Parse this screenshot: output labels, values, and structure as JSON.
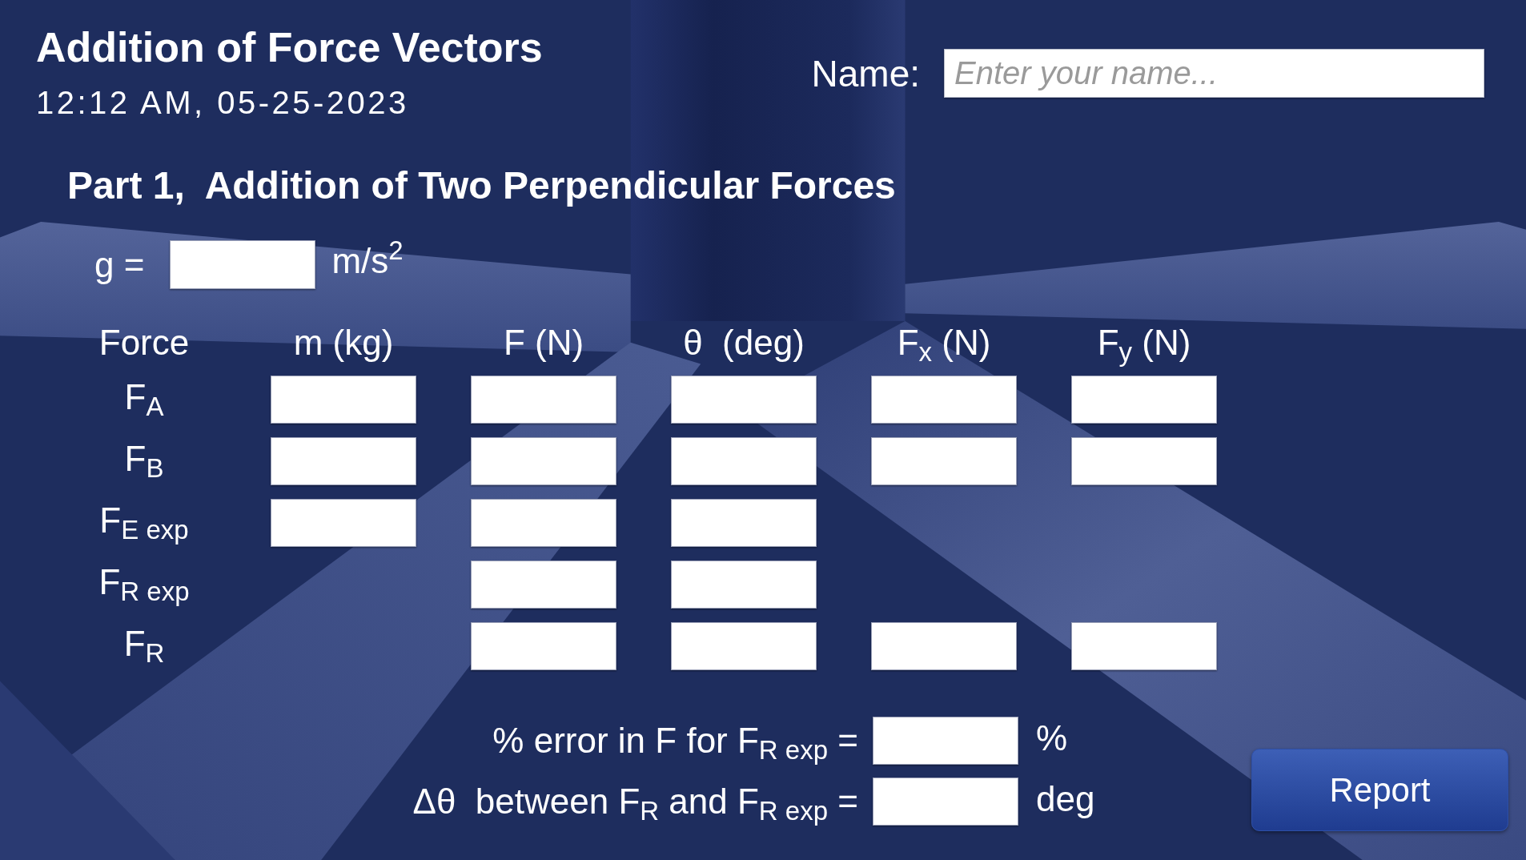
{
  "title": "Addition of Force Vectors",
  "timestamp": "12:12 AM, 05-25-2023",
  "name_field": {
    "label": "Name:",
    "placeholder": "Enter your name..."
  },
  "part_1": {
    "heading": "Part 1,  Addition of Two Perpendicular Forces",
    "gravity": {
      "label": "g =",
      "unit": "m/s$^{2}$"
    },
    "table": {
      "columns": [
        "Force",
        "m (kg)",
        "F (N)",
        "θ  (deg)",
        "F$_{x}$ (N)",
        "F$_{y}$ (N)"
      ],
      "rows": [
        {
          "label": "F$_{A}$",
          "cells": [
            {
              "kind": "input"
            },
            {
              "kind": "input"
            },
            {
              "kind": "input"
            },
            {
              "kind": "input"
            },
            {
              "kind": "input"
            }
          ]
        },
        {
          "label": "F$_{B}$",
          "cells": [
            {
              "kind": "input"
            },
            {
              "kind": "input"
            },
            {
              "kind": "input"
            },
            {
              "kind": "input"
            },
            {
              "kind": "input"
            }
          ]
        },
        {
          "label": "F$_{E exp}$",
          "cells": [
            {
              "kind": "input"
            },
            {
              "kind": "input"
            },
            {
              "kind": "input"
            },
            {
              "kind": "blank"
            },
            {
              "kind": "blank"
            }
          ]
        },
        {
          "label": "F$_{R exp}$",
          "cells": [
            {
              "kind": "blank"
            },
            {
              "kind": "input"
            },
            {
              "kind": "input"
            },
            {
              "kind": "blank"
            },
            {
              "kind": "blank"
            }
          ]
        },
        {
          "label": "F$_{R}$",
          "cells": [
            {
              "kind": "blank"
            },
            {
              "kind": "input"
            },
            {
              "kind": "input"
            },
            {
              "kind": "input"
            },
            {
              "kind": "input"
            }
          ]
        }
      ]
    },
    "results": [
      {
        "label": "% error in F for F$_{R exp}$ =",
        "unit": "%"
      },
      {
        "label": "Δθ  between F$_{R}$ and F$_{R exp}$ =",
        "unit": "deg"
      }
    ]
  },
  "report_button": {
    "label": "Report"
  }
}
